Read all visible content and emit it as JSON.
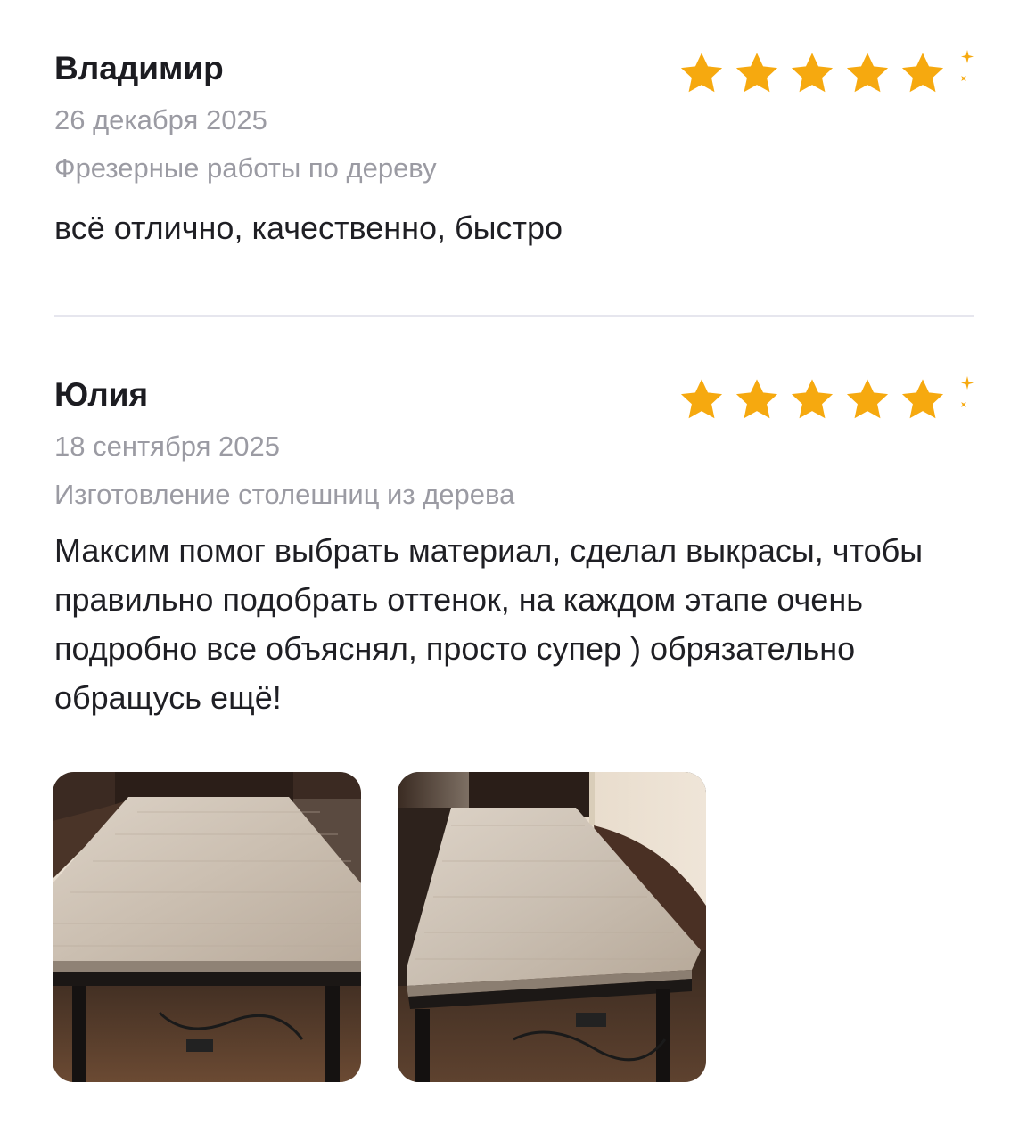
{
  "reviews": [
    {
      "author": "Владимир",
      "date": "26 декабря 2025",
      "service": "Фрезерные работы по дереву",
      "text": "всё отлично, качественно, быстро",
      "rating": 5
    },
    {
      "author": "Юлия",
      "date": "18 сентября 2025",
      "service": "Изготовление столешниц из дерева",
      "text": "Максим помог выбрать материал, сделал выкрасы, чтобы правильно подобрать оттенок, на каждом этапе очень подробно все объяснял, просто супер ) обрязательно обращусь ещё!",
      "rating": 5,
      "photos": [
        "table-photo-1",
        "table-photo-2"
      ]
    }
  ],
  "colors": {
    "star": "#f6a90f",
    "muted_text": "#9b9ba3",
    "divider": "#e6e6ee"
  }
}
